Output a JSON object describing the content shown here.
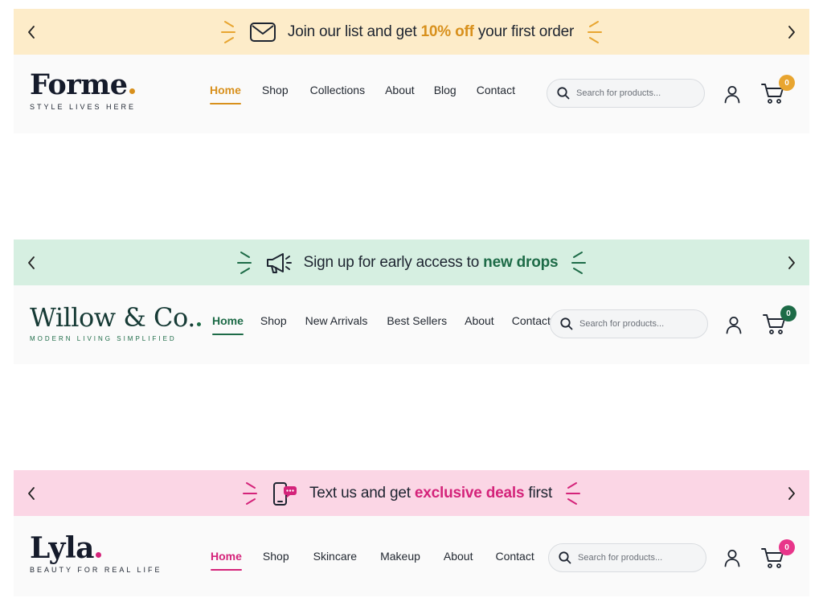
{
  "headers": [
    {
      "id": "forme",
      "accent": "#d8901c",
      "band_bg": "#fdecc9",
      "announcement": {
        "icon": "envelope-icon",
        "prefix": "Join our list and get ",
        "highlight": "10% off",
        "suffix": " your first order"
      },
      "logo": {
        "name": "Forme",
        "tagline": "STYLE LIVES HERE"
      },
      "nav": [
        {
          "label": "Home",
          "active": true
        },
        {
          "label": "Shop"
        },
        {
          "label": "Collections"
        },
        {
          "label": "About"
        },
        {
          "label": "Blog"
        },
        {
          "label": "Contact"
        }
      ],
      "search": {
        "placeholder": "Search for products..."
      },
      "cart": {
        "count": "0"
      }
    },
    {
      "id": "willow",
      "accent": "#1d6b47",
      "band_bg": "#d6efe1",
      "announcement": {
        "icon": "megaphone-icon",
        "prefix": "Sign up for early access to ",
        "highlight": "new drops",
        "suffix": ""
      },
      "logo": {
        "name": "Willow & Co.",
        "tagline": "MODERN LIVING SIMPLIFIED"
      },
      "nav": [
        {
          "label": "Home",
          "active": true
        },
        {
          "label": "Shop"
        },
        {
          "label": "New Arrivals"
        },
        {
          "label": "Best Sellers"
        },
        {
          "label": "About"
        },
        {
          "label": "Contact"
        }
      ],
      "search": {
        "placeholder": "Search for products..."
      },
      "cart": {
        "count": "0"
      }
    },
    {
      "id": "lyla",
      "accent": "#d4237a",
      "band_bg": "#fbd6e5",
      "announcement": {
        "icon": "phone-chat-icon",
        "prefix": "Text us and get ",
        "highlight": "exclusive deals",
        "suffix": " first"
      },
      "logo": {
        "name": "Lyla",
        "tagline": "BEAUTY FOR REAL LIFE"
      },
      "nav": [
        {
          "label": "Home",
          "active": true
        },
        {
          "label": "Shop"
        },
        {
          "label": "Skincare"
        },
        {
          "label": "Makeup"
        },
        {
          "label": "About"
        },
        {
          "label": "Contact"
        }
      ],
      "search": {
        "placeholder": "Search for products..."
      },
      "cart": {
        "count": "0"
      }
    }
  ]
}
